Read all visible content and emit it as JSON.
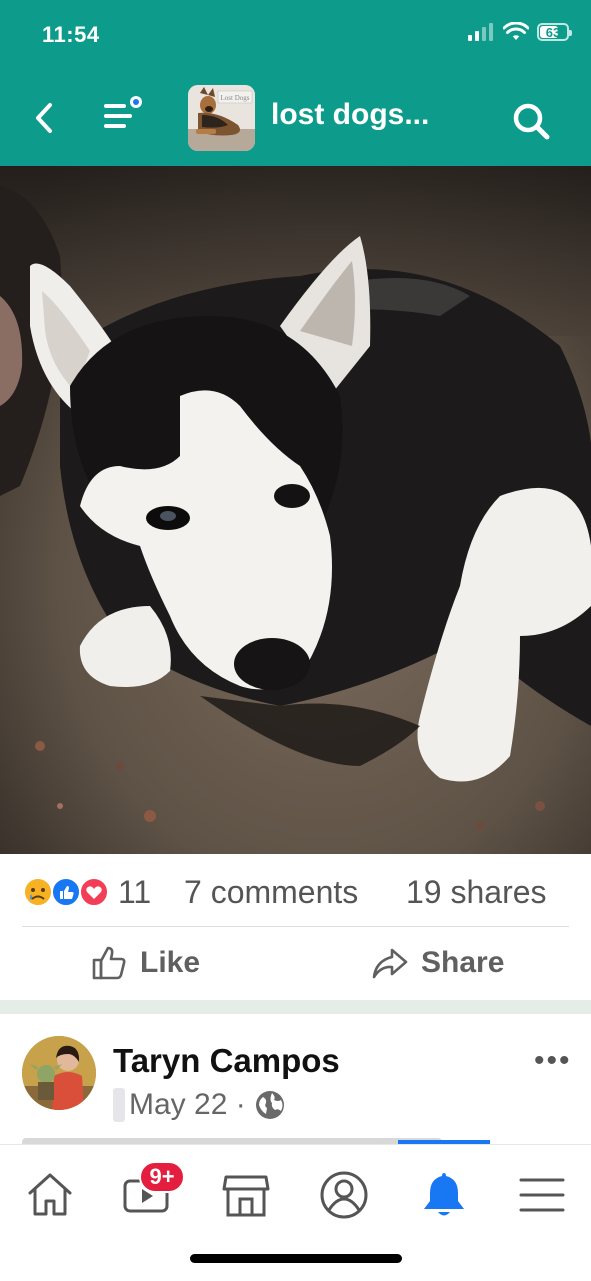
{
  "status_bar": {
    "time": "11:54",
    "battery": "63"
  },
  "header": {
    "group_title": "lost dogs...",
    "thumb_caption": "Lost Dogs"
  },
  "post": {
    "reaction_count": "11",
    "comments": "7 comments",
    "shares": "19 shares",
    "like_label": "Like",
    "share_label": "Share"
  },
  "next_post": {
    "author": "Taryn Campos",
    "date": "May 22 ·"
  },
  "tabbar": {
    "video_badge": "9+"
  },
  "colors": {
    "header_bg": "#0d9c8b",
    "fb_blue": "#1877f2",
    "badge_red": "#e41e3f",
    "love_red": "#f33e58"
  },
  "icons": [
    "back-icon",
    "menu-notification-icon",
    "search-icon",
    "sad-reaction-icon",
    "like-reaction-icon",
    "love-reaction-icon",
    "thumbs-up-icon",
    "share-arrow-icon",
    "globe-icon",
    "home-icon",
    "video-icon",
    "marketplace-icon",
    "profile-icon",
    "bell-icon",
    "menu-icon"
  ]
}
